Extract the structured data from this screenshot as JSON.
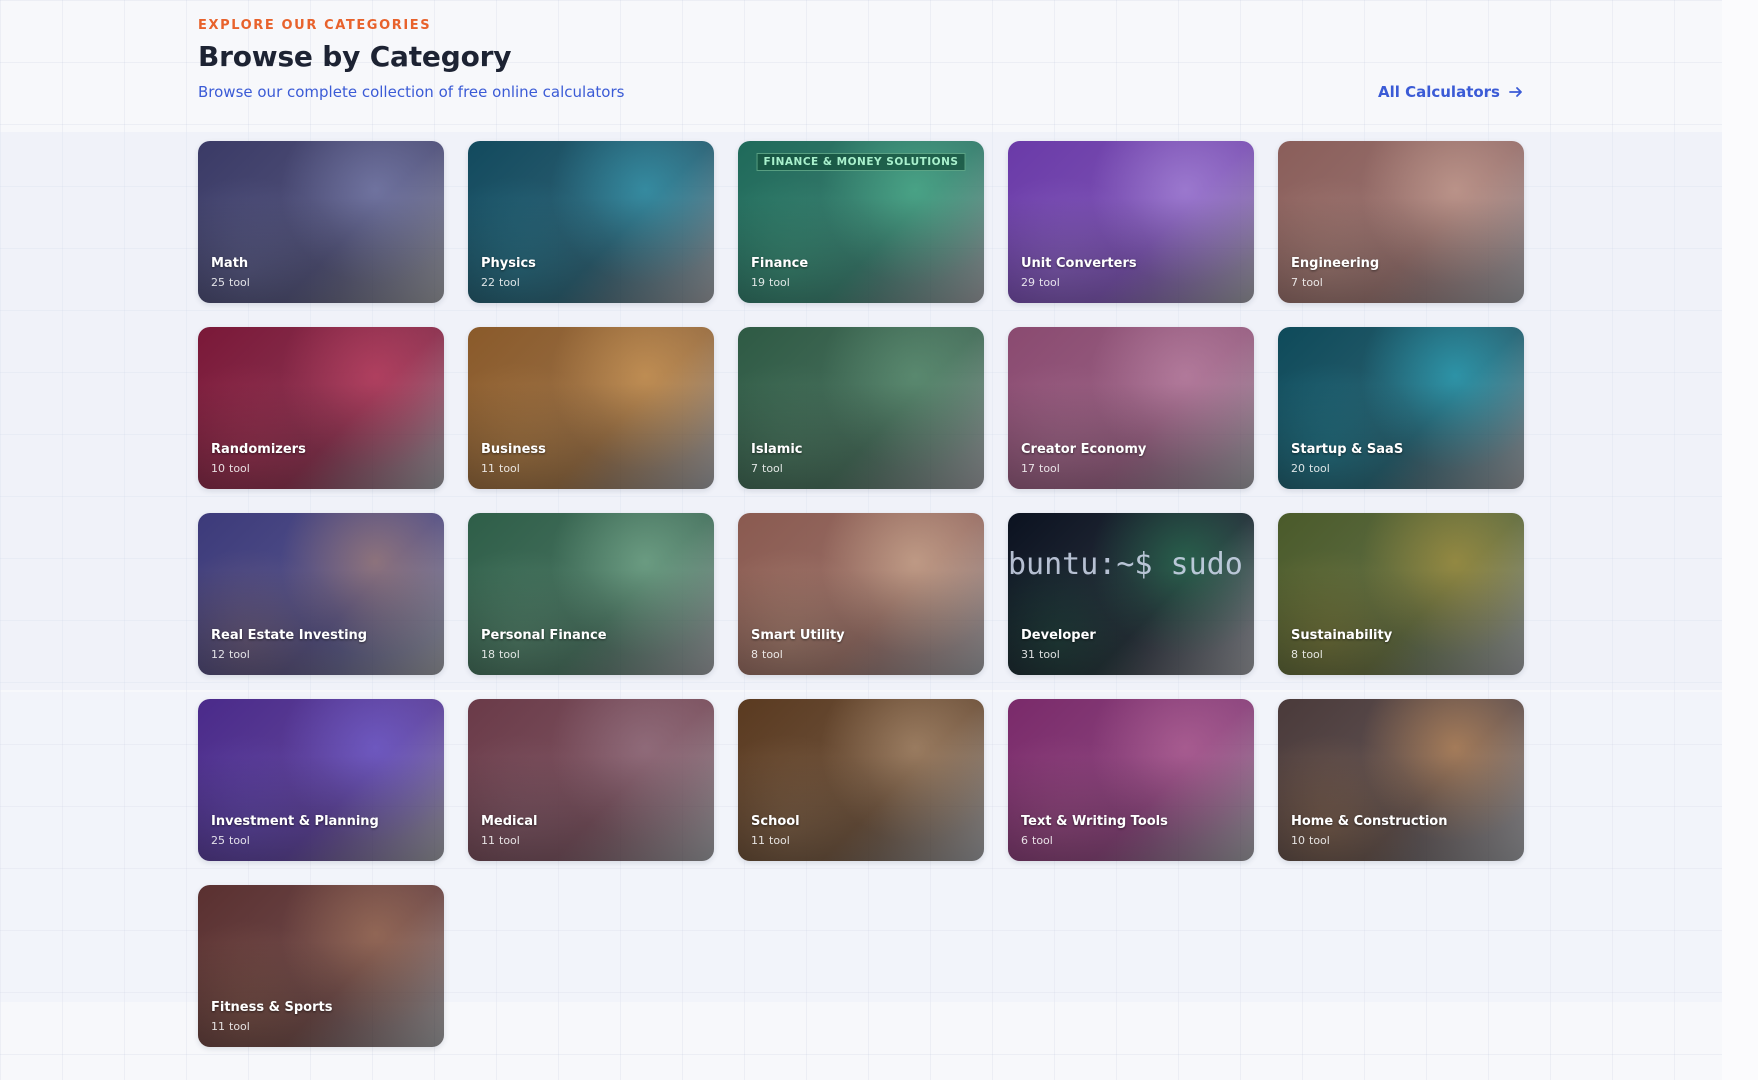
{
  "header": {
    "eyebrow": "EXPLORE OUR CATEGORIES",
    "title": "Browse by Category",
    "subtitle": "Browse our complete collection of free online calculators",
    "all_link": "All Calculators"
  },
  "categories": [
    {
      "name": "Math",
      "count": "25",
      "unit": "tool",
      "icon": "chalkboard-image",
      "color": "#3a3a66",
      "accent": "#8a90c0"
    },
    {
      "name": "Physics",
      "count": "22",
      "unit": "tool",
      "icon": "atom-image",
      "color": "#124a5e",
      "accent": "#3cb0c8"
    },
    {
      "name": "Finance",
      "count": "19",
      "unit": "tool",
      "icon": "trading-floor-image",
      "color": "#1f6a5a",
      "accent": "#57c49a",
      "banner": "FINANCE & MONEY SOLUTIONS"
    },
    {
      "name": "Unit Converters",
      "count": "29",
      "unit": "tool",
      "icon": "scale-image",
      "color": "#6a3aa8",
      "accent": "#b79ae6"
    },
    {
      "name": "Engineering",
      "count": "7",
      "unit": "tool",
      "icon": "lab-image",
      "color": "#8a5e5a",
      "accent": "#d8b0a0"
    },
    {
      "name": "Randomizers",
      "count": "10",
      "unit": "tool",
      "icon": "cards-dice-image",
      "color": "#7a1838",
      "accent": "#d04a6c"
    },
    {
      "name": "Business",
      "count": "11",
      "unit": "tool",
      "icon": "laptop-office-image",
      "color": "#8a5a2a",
      "accent": "#e0a860"
    },
    {
      "name": "Islamic",
      "count": "7",
      "unit": "tool",
      "icon": "mosque-image",
      "color": "#2e5a44",
      "accent": "#6aa080"
    },
    {
      "name": "Creator Economy",
      "count": "17",
      "unit": "tool",
      "icon": "creator-image",
      "color": "#8a4a70",
      "accent": "#c890b0"
    },
    {
      "name": "Startup & SaaS",
      "count": "20",
      "unit": "tool",
      "icon": "dashboard-image",
      "color": "#0e4a5a",
      "accent": "#30c0d8"
    },
    {
      "name": "Real Estate Investing",
      "count": "12",
      "unit": "tool",
      "icon": "house-image",
      "color": "#3c3a7a",
      "accent": "#c09070"
    },
    {
      "name": "Personal Finance",
      "count": "18",
      "unit": "tool",
      "icon": "cash-image",
      "color": "#2e5e48",
      "accent": "#8ac0a0"
    },
    {
      "name": "Smart Utility",
      "count": "8",
      "unit": "tool",
      "icon": "workshop-image",
      "color": "#8a5a50",
      "accent": "#e0c0a0"
    },
    {
      "name": "Developer",
      "count": "31",
      "unit": "tool",
      "icon": "terminal-image",
      "color": "#0b1220",
      "accent": "#2a8a5a",
      "terminal": "buntu:~$ sudo"
    },
    {
      "name": "Sustainability",
      "count": "8",
      "unit": "tool",
      "icon": "power-lines-image",
      "color": "#4a5a2a",
      "accent": "#c0a040"
    },
    {
      "name": "Investment & Planning",
      "count": "25",
      "unit": "tool",
      "icon": "stock-charts-image",
      "color": "#4a2a8a",
      "accent": "#7a6ae0"
    },
    {
      "name": "Medical",
      "count": "11",
      "unit": "tool",
      "icon": "hospital-image",
      "color": "#6a3a48",
      "accent": "#a08090"
    },
    {
      "name": "School",
      "count": "11",
      "unit": "tool",
      "icon": "notebook-image",
      "color": "#5a3a20",
      "accent": "#c0a080"
    },
    {
      "name": "Text & Writing Tools",
      "count": "6",
      "unit": "tool",
      "icon": "typewriter-image",
      "color": "#7a2a6a",
      "accent": "#c070a0"
    },
    {
      "name": "Home & Construction",
      "count": "10",
      "unit": "tool",
      "icon": "construction-image",
      "color": "#4a3a3a",
      "accent": "#e0a060"
    },
    {
      "name": "Fitness & Sports",
      "count": "11",
      "unit": "tool",
      "icon": "gym-image",
      "color": "#5a3030",
      "accent": "#b08060"
    }
  ]
}
